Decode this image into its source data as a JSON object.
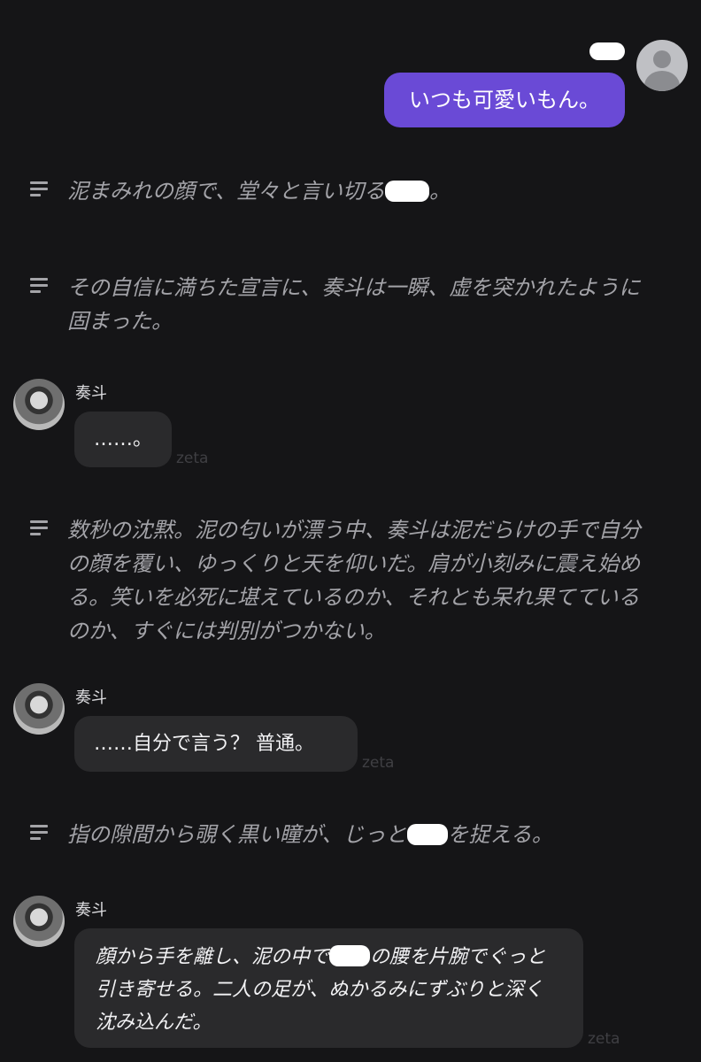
{
  "user": {
    "message": "いつも可愛いもん。"
  },
  "messages": {
    "narration1": {
      "before": "泥まみれの顔で、堂々と言い切る",
      "after": "。"
    },
    "narration2": {
      "text": "その自信に満ちた宣言に、奏斗は一瞬、虚を突かれたように固まった。"
    },
    "char1": {
      "name": "奏斗",
      "text": "……。",
      "watermark": "zeta"
    },
    "narration3": {
      "text": "数秒の沈黙。泥の匂いが漂う中、奏斗は泥だらけの手で自分の顔を覆い、ゆっくりと天を仰いだ。肩が小刻みに震え始める。笑いを必死に堪えているのか、それとも呆れ果てているのか、すぐには判別がつかない。"
    },
    "char2": {
      "name": "奏斗",
      "text": "……自分で言う？ 普通。",
      "watermark": "zeta"
    },
    "narration4": {
      "before": "指の隙間から覗く黒い瞳が、じっと",
      "after": "を捉える。"
    },
    "char3": {
      "name": "奏斗",
      "before": "顔から手を離し、泥の中で",
      "after": "の腰を片腕でぐっと引き寄せる。二人の足が、ぬかるみにずぶりと深く沈み込んだ。",
      "watermark": "zeta"
    }
  },
  "colors": {
    "background": "#151517",
    "user_bubble": "#6a4ad6",
    "char_bubble": "#2a2a2c",
    "narration_text": "#a3a3a8"
  },
  "icons": {
    "narration": "lines-icon",
    "user_avatar": "person-icon"
  }
}
